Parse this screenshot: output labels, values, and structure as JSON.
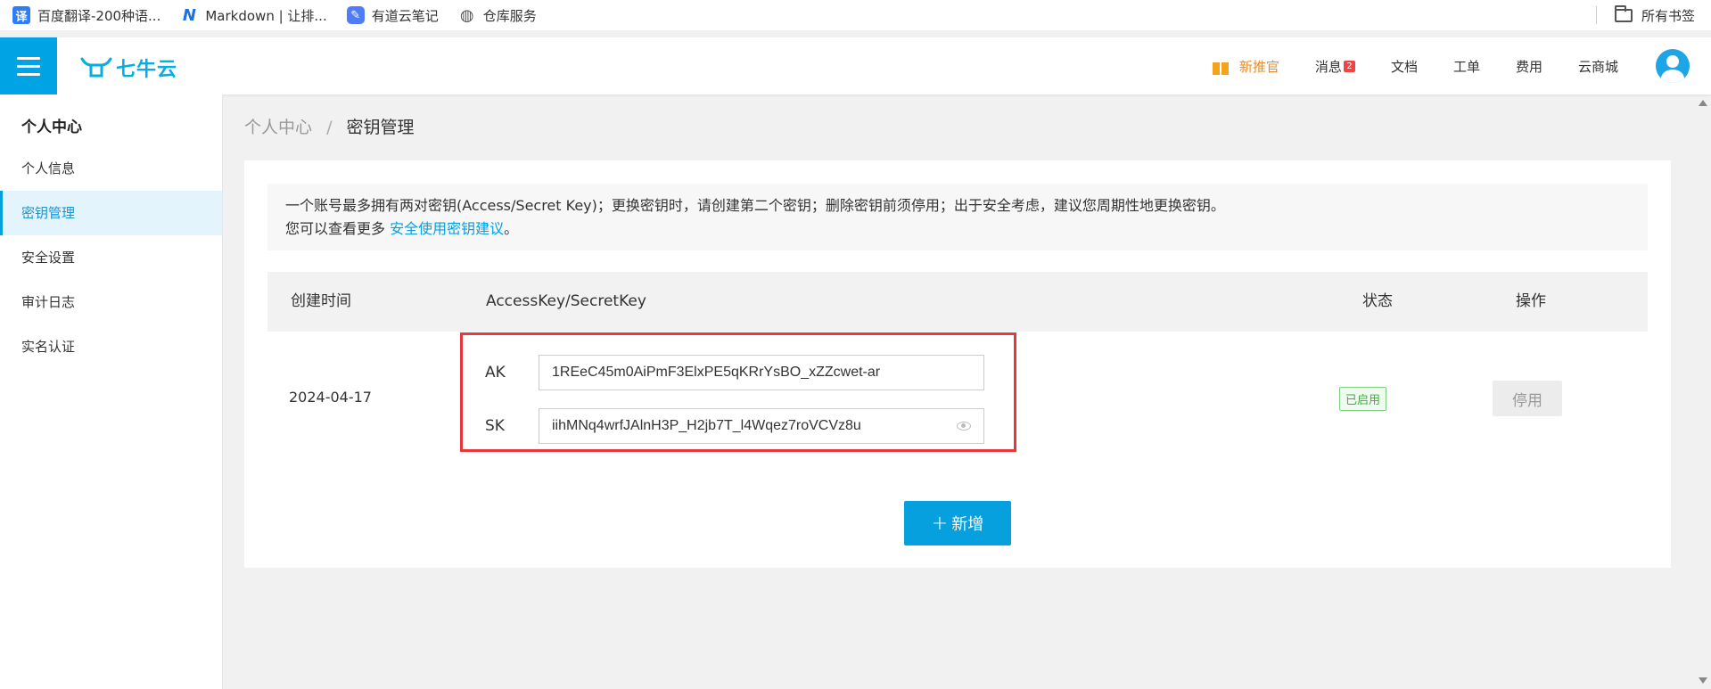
{
  "bookmarks": {
    "items": [
      {
        "icon": "baidu-translate-icon",
        "label": "百度翻译-200种语..."
      },
      {
        "icon": "markdown-icon",
        "label": "Markdown | 让排..."
      },
      {
        "icon": "youdao-note-icon",
        "label": "有道云笔记"
      },
      {
        "icon": "globe-icon",
        "label": "仓库服务"
      }
    ],
    "all_bookmarks": "所有书签"
  },
  "header": {
    "logo_text": "七牛云",
    "nav": {
      "new_label": "新推官",
      "messages_label": "消息",
      "messages_count": "2",
      "docs_label": "文档",
      "tickets_label": "工单",
      "billing_label": "费用",
      "market_label": "云商城"
    }
  },
  "sidebar": {
    "title": "个人中心",
    "items": [
      {
        "label": "个人信息",
        "active": false
      },
      {
        "label": "密钥管理",
        "active": true
      },
      {
        "label": "安全设置",
        "active": false
      },
      {
        "label": "审计日志",
        "active": false
      },
      {
        "label": "实名认证",
        "active": false
      }
    ]
  },
  "breadcrumb": {
    "parent": "个人中心",
    "separator": "/",
    "current": "密钥管理"
  },
  "notice": {
    "line1": "一个账号最多拥有两对密钥(Access/Secret Key)；更换密钥时，请创建第二个密钥；删除密钥前须停用；出于安全考虑，建议您周期性地更换密钥。",
    "line2_prefix": "您可以查看更多 ",
    "line2_link": "安全使用密钥建议",
    "line2_suffix": "。"
  },
  "table": {
    "headers": {
      "created": "创建时间",
      "keys": "AccessKey/SecretKey",
      "status": "状态",
      "actions": "操作"
    },
    "rows": [
      {
        "created": "2024-04-17",
        "ak_label": "AK",
        "ak_value": "1REeC45m0AiPmF3ElxPE5qKRrYsBO_xZZcwet-ar",
        "sk_label": "SK",
        "sk_value": "iihMNq4wrfJAlnH3P_H2jb7T_l4Wqez7roVCVz8u",
        "status": "已启用",
        "action": "停用"
      }
    ]
  },
  "add_button": {
    "plus": "+",
    "label": "新增"
  },
  "colors": {
    "accent": "#06a0df",
    "highlight_border": "#e63a3a",
    "status_green": "#3cb03c",
    "new_orange": "#f38a19"
  }
}
